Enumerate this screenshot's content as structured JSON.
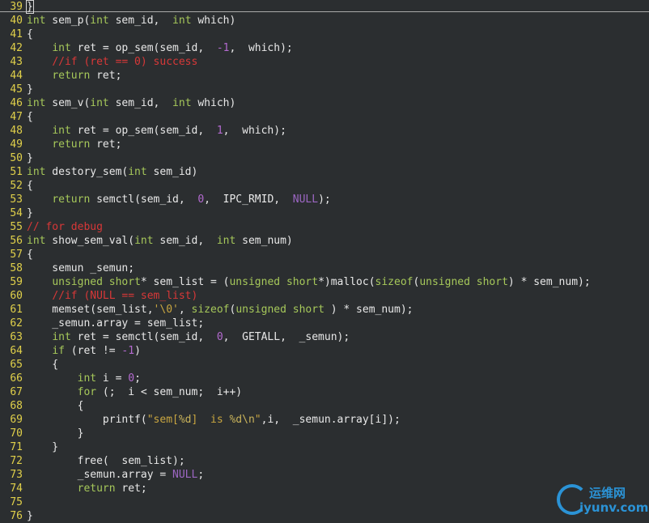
{
  "editor": {
    "lines": [
      {
        "n": "39",
        "t": "}"
      },
      {
        "n": "40",
        "t": "int sem_p(int sem_id,  int which)"
      },
      {
        "n": "41",
        "t": "{"
      },
      {
        "n": "42",
        "t": "    int ret = op_sem(sem_id,  -1,  which);"
      },
      {
        "n": "43",
        "t": "    //if (ret == 0) success"
      },
      {
        "n": "44",
        "t": "    return ret;"
      },
      {
        "n": "45",
        "t": "}"
      },
      {
        "n": "46",
        "t": "int sem_v(int sem_id,  int which)"
      },
      {
        "n": "47",
        "t": "{"
      },
      {
        "n": "48",
        "t": "    int ret = op_sem(sem_id,  1,  which);"
      },
      {
        "n": "49",
        "t": "    return ret;"
      },
      {
        "n": "50",
        "t": "}"
      },
      {
        "n": "51",
        "t": "int destory_sem(int sem_id)"
      },
      {
        "n": "52",
        "t": "{"
      },
      {
        "n": "53",
        "t": "    return semctl(sem_id,  0,  IPC_RMID,  NULL);"
      },
      {
        "n": "54",
        "t": "}"
      },
      {
        "n": "55",
        "t": "// for debug"
      },
      {
        "n": "56",
        "t": "int show_sem_val(int sem_id,  int sem_num)"
      },
      {
        "n": "57",
        "t": "{"
      },
      {
        "n": "58",
        "t": "    semun _semun;"
      },
      {
        "n": "59",
        "t": "    unsigned short* sem_list = (unsigned short*)malloc(sizeof(unsigned short) * sem_num);"
      },
      {
        "n": "60",
        "t": "    //if (NULL == sem_list)"
      },
      {
        "n": "61",
        "t": "    memset(sem_list,'\\0', sizeof(unsigned short ) * sem_num);"
      },
      {
        "n": "62",
        "t": "    _semun.array = sem_list;"
      },
      {
        "n": "63",
        "t": "    int ret = semctl(sem_id,  0,  GETALL,  _semun);"
      },
      {
        "n": "64",
        "t": "    if (ret != -1)"
      },
      {
        "n": "65",
        "t": "    {"
      },
      {
        "n": "66",
        "t": "        int i = 0;"
      },
      {
        "n": "67",
        "t": "        for (;  i < sem_num;  i++)"
      },
      {
        "n": "68",
        "t": "        {"
      },
      {
        "n": "69",
        "t": "            printf(\"sem[%d]  is %d\\n\",i,  _semun.array[i]);"
      },
      {
        "n": "70",
        "t": "        }"
      },
      {
        "n": "71",
        "t": "    }"
      },
      {
        "n": "72",
        "t": "        free(  sem_list);"
      },
      {
        "n": "73",
        "t": "        _semun.array = NULL;"
      },
      {
        "n": "74",
        "t": "        return ret;"
      },
      {
        "n": "75",
        "t": ""
      },
      {
        "n": "76",
        "t": "}"
      }
    ]
  },
  "watermark": {
    "cn": "运维网",
    "en": "iyunv.com"
  },
  "colors": {
    "background": "#2b2e30",
    "line_number": "#e0d04a",
    "keyword": "#a6c85a",
    "comment": "#d83838",
    "number": "#b46ad0",
    "string": "#c9a640"
  }
}
